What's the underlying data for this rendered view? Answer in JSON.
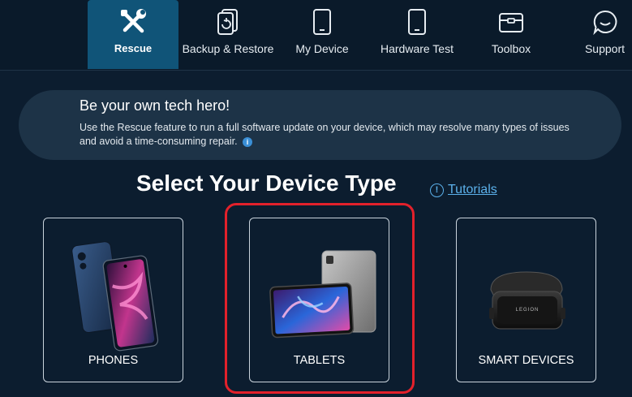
{
  "nav": {
    "items": [
      {
        "label": "Rescue",
        "icon": "wrench-screwdriver-icon",
        "active": true
      },
      {
        "label": "Backup & Restore",
        "icon": "backup-restore-icon",
        "active": false
      },
      {
        "label": "My Device",
        "icon": "phone-icon",
        "active": false
      },
      {
        "label": "Hardware Test",
        "icon": "phone-test-icon",
        "active": false
      },
      {
        "label": "Toolbox",
        "icon": "toolbox-icon",
        "active": false
      },
      {
        "label": "Support",
        "icon": "chat-support-icon",
        "active": false
      }
    ]
  },
  "hero": {
    "title": "Be your own tech hero!",
    "description": "Use the Rescue feature to run a full software update on your device, which may resolve many types of issues and avoid a time-consuming repair."
  },
  "section": {
    "title": "Select Your Device Type",
    "tutorials_label": "Tutorials"
  },
  "devices": [
    {
      "label": "PHONES"
    },
    {
      "label": "TABLETS"
    },
    {
      "label": "SMART DEVICES"
    }
  ],
  "colors": {
    "background": "#0c1d2f",
    "active_tab": "#105478",
    "accent_link": "#5bb0ea",
    "highlight": "#e3212b"
  },
  "legion_label": "LEGION"
}
